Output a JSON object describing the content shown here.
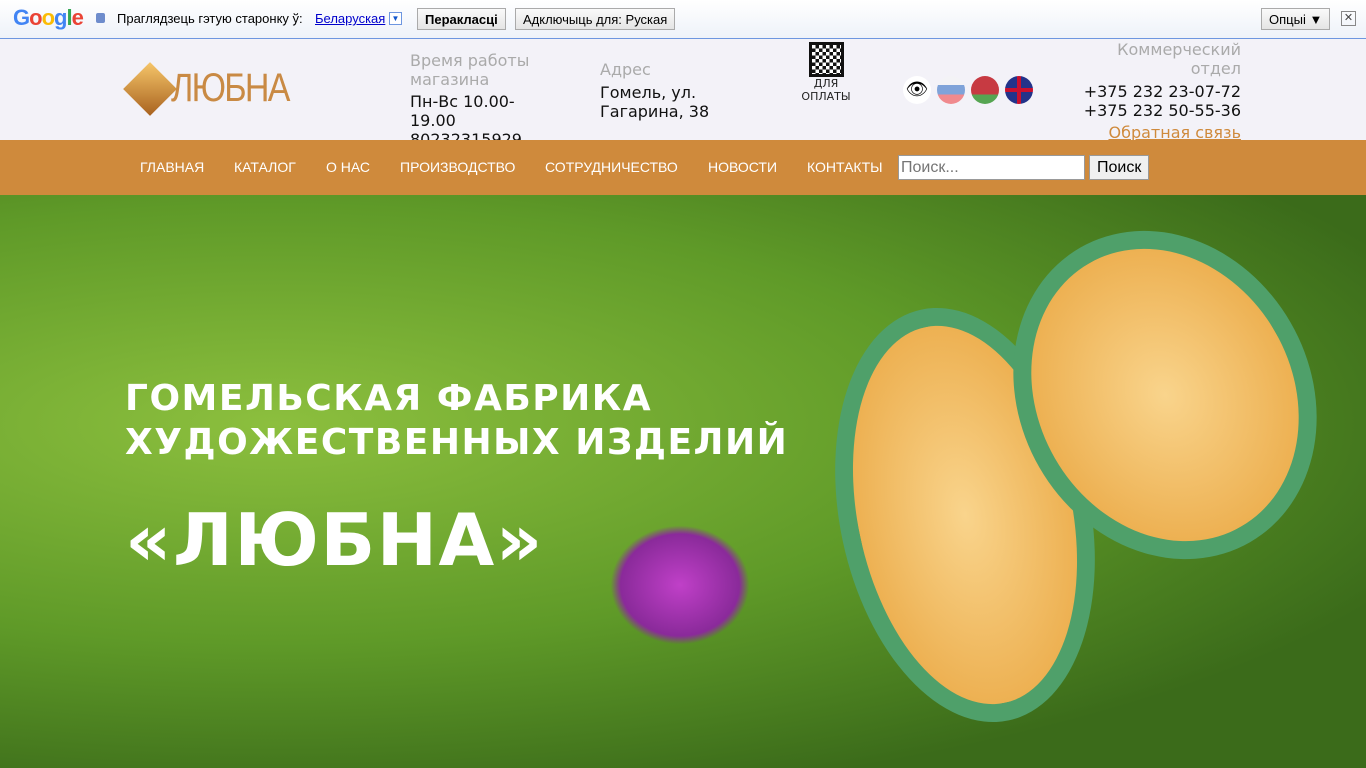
{
  "translate_bar": {
    "brand": "Google",
    "prompt": "Праглядзець гэтую старонку ў:",
    "language": "Беларуская",
    "translate_button": "Перакласці",
    "disable_button": "Адключыць для: Руская",
    "options_button": "Опцыі ▼",
    "close": "✕"
  },
  "header": {
    "logo": "ЛЮБНА",
    "hours_label": "Время работы магазина",
    "hours": "Пн-Вс 10.00-19.00",
    "shop_phone": "80232315929",
    "address_label": "Адрес",
    "address": "Гомель, ул. Гагарина, 38",
    "qr_caption": "ДЛЯ ОПЛАТЫ",
    "commercial_label": "Коммерческий отдел",
    "phone1": "+375 232 23-07-72",
    "phone2": "+375 232 50-55-36",
    "feedback": "Обратная связь"
  },
  "nav": {
    "items": [
      "ГЛАВНАЯ",
      "КАТАЛОГ",
      "О НАС",
      "ПРОИЗВОДСТВО",
      "СОТРУДНИЧЕСТВО",
      "НОВОСТИ",
      "КОНТАКТЫ"
    ],
    "search_placeholder": "Поиск...",
    "search_button": "Поиск"
  },
  "hero": {
    "line1": "ГОМЕЛЬСКАЯ ФАБРИКА",
    "line2": "ХУДОЖЕСТВЕННЫХ ИЗДЕЛИЙ",
    "name": "«ЛЮБНА»"
  },
  "colors": {
    "accent": "#cf8a3c",
    "header_bg": "#f3f2f8"
  }
}
